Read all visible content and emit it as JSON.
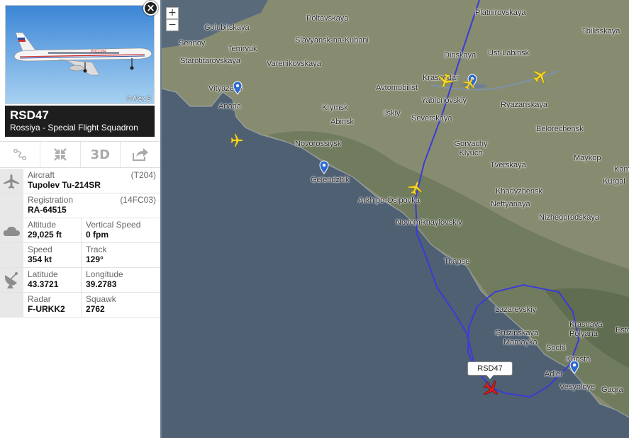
{
  "panel": {
    "close_label": "×",
    "photo_credit": "© Alex S",
    "callsign": "RSD47",
    "airline": "Rossiya - Special Flight Squadron",
    "livery_text": "РОССИЯ",
    "toolbar": {
      "route_icon": "route-icon",
      "fit_icon": "fit-to-screen-icon",
      "view3d_label": "3D",
      "share_icon": "share-icon"
    },
    "aircraft": {
      "label": "Aircraft",
      "code": "(T204)",
      "value": "Tupolev Tu-214SR"
    },
    "registration": {
      "label": "Registration",
      "code": "(14FC03)",
      "value": "RA-64515"
    },
    "altitude": {
      "label": "Altitude",
      "value": "29,025 ft"
    },
    "vspeed": {
      "label": "Vertical Speed",
      "value": "0 fpm"
    },
    "speed": {
      "label": "Speed",
      "value": "354 kt"
    },
    "track": {
      "label": "Track",
      "value": "129°"
    },
    "latitude": {
      "label": "Latitude",
      "value": "43.3721"
    },
    "longitude": {
      "label": "Longitude",
      "value": "39.2783"
    },
    "radar": {
      "label": "Radar",
      "value": "F-URKK2"
    },
    "squawk": {
      "label": "Squawk",
      "value": "2762"
    }
  },
  "map": {
    "zoom_in": "+",
    "zoom_out": "−",
    "selected_flight_label": "RSD47",
    "colors": {
      "sea": "#4e5f71",
      "land": "#8a8f74",
      "track": "#3535d0",
      "plane": "#f2d629",
      "selected_plane": "#d81e1e",
      "pin": "#2e6ad0"
    },
    "cities": [
      {
        "name": "Poltavskaya"
      },
      {
        "name": "Platnirovskaya"
      },
      {
        "name": "Golubitskaya"
      },
      {
        "name": "Slavyansk-na-Kubani"
      },
      {
        "name": "Tbilisskaya"
      },
      {
        "name": "Sennoy"
      },
      {
        "name": "Temryuk"
      },
      {
        "name": "Dinskaya"
      },
      {
        "name": "Ust-Labinsk"
      },
      {
        "name": "Starotitarovskaya"
      },
      {
        "name": "Varenikovskaya"
      },
      {
        "name": "Krasnodar"
      },
      {
        "name": "Vityazevo"
      },
      {
        "name": "Avtomobilist"
      },
      {
        "name": "Yablonovskiy"
      },
      {
        "name": "Ryazanskaya"
      },
      {
        "name": "Anapa"
      },
      {
        "name": "Krymsk"
      },
      {
        "name": "Ilskiy"
      },
      {
        "name": "Severskaya"
      },
      {
        "name": "Abinsk"
      },
      {
        "name": "Belorechensk"
      },
      {
        "name": "Novorossiysk"
      },
      {
        "name": "Goryachy Klyuch"
      },
      {
        "name": "Maykop"
      },
      {
        "name": "Tverskaya"
      },
      {
        "name": "Gelendzhik"
      },
      {
        "name": "Khadyzhensk"
      },
      {
        "name": "Arkhipo-Osipovka"
      },
      {
        "name": "Neftyanaya"
      },
      {
        "name": "Nizhegorodskaya"
      },
      {
        "name": "Novomikhaylovskiy"
      },
      {
        "name": "Tuapse"
      },
      {
        "name": "Lazarevskiy"
      },
      {
        "name": "Gruzinskaya"
      },
      {
        "name": "Mamayka"
      },
      {
        "name": "Sochi"
      },
      {
        "name": "Krasnaya Polyana"
      },
      {
        "name": "Khosta"
      },
      {
        "name": "Adler"
      },
      {
        "name": "Vesyoloye"
      },
      {
        "name": "Gagra"
      },
      {
        "name": "Kurgal"
      },
      {
        "name": "Kamenno"
      },
      {
        "name": "Este"
      }
    ]
  }
}
